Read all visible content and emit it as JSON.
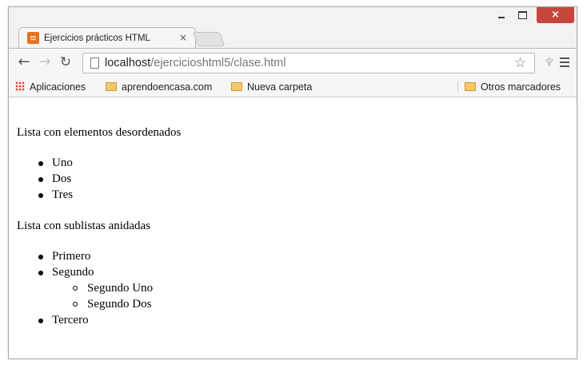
{
  "browser": {
    "tab_title": "Ejercicios prácticos HTML",
    "tab_close": "×",
    "window_close": "×",
    "url_host": "localhost",
    "url_path": "/ejercicioshtml5/clase.html",
    "bookmarks": {
      "apps": "Aplicaciones",
      "items": [
        "aprendoencasa.com",
        "Nueva carpeta"
      ],
      "other": "Otros marcadores"
    },
    "colors": {
      "close": "#c7453c",
      "favicon": "#e8711c",
      "folder": "#f3c96a"
    }
  },
  "page": {
    "heading_1": "Lista con elementos desordenados",
    "list_1": [
      "Uno",
      "Dos",
      "Tres"
    ],
    "heading_2": "Lista con sublistas anidadas",
    "list_2": [
      {
        "label": "Primero"
      },
      {
        "label": "Segundo",
        "children": [
          "Segundo Uno",
          "Segundo Dos"
        ]
      },
      {
        "label": "Tercero"
      }
    ]
  }
}
